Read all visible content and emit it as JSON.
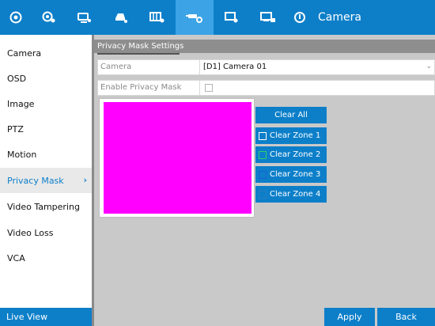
{
  "topbar": {
    "title": "Camera",
    "icons": [
      "camera-icon",
      "image-icon",
      "record-icon",
      "hdd-icon",
      "storage-icon",
      "camera-settings-icon",
      "network-icon",
      "system-icon",
      "power-icon"
    ]
  },
  "sidebar": {
    "items": [
      {
        "label": "Camera"
      },
      {
        "label": "OSD"
      },
      {
        "label": "Image"
      },
      {
        "label": "PTZ"
      },
      {
        "label": "Motion"
      },
      {
        "label": "Privacy Mask",
        "active": true
      },
      {
        "label": "Video Tampering"
      },
      {
        "label": "Video Loss"
      },
      {
        "label": "VCA"
      }
    ],
    "live_view": "Live View"
  },
  "main": {
    "panel_title": "Privacy Mask Settings",
    "camera_label": "Camera",
    "camera_value": "[D1] Camera 01",
    "enable_label": "Enable Privacy Mask",
    "clear_all": "Clear All",
    "zones": [
      {
        "label": "Clear Zone 1",
        "color": "#ffffff"
      },
      {
        "label": "Clear Zone 2",
        "color": "#2ecc71"
      },
      {
        "label": "Clear Zone 3",
        "color": "#1a5fd6"
      },
      {
        "label": "Clear Zone 4",
        "color": "#2a7ac0"
      }
    ],
    "apply": "Apply",
    "back": "Back"
  },
  "colors": {
    "accent": "#0d7fc9",
    "mask": "#ff00ff"
  }
}
